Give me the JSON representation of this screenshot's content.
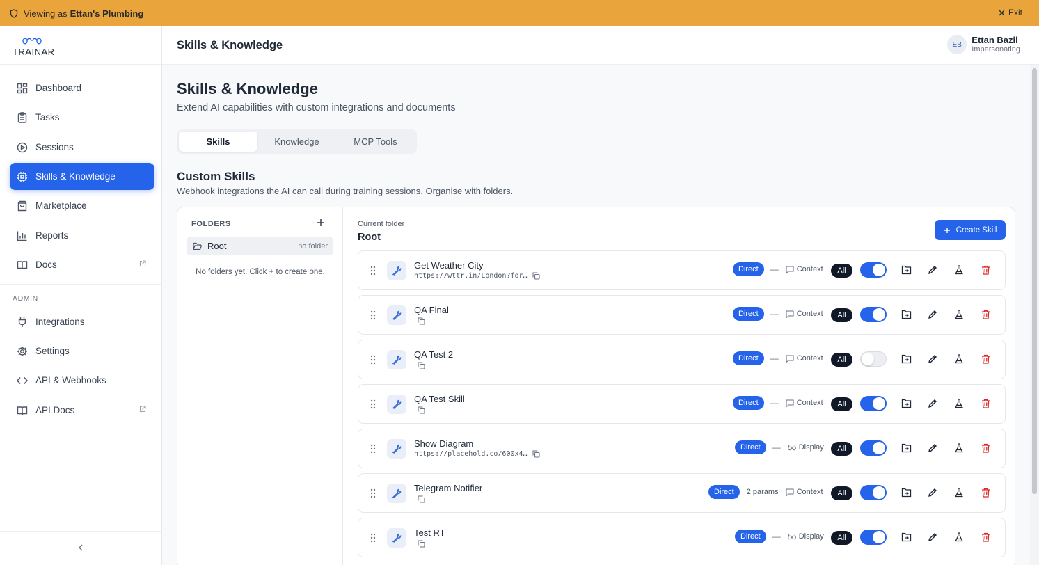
{
  "banner": {
    "prefix": "Viewing as",
    "account": "Ettan's Plumbing",
    "exit_label": "Exit",
    "color": "#e9a43b"
  },
  "brand": {
    "name": "TRAINAR"
  },
  "sidebar": {
    "items": [
      {
        "label": "Dashboard",
        "icon": "dashboard-icon"
      },
      {
        "label": "Tasks",
        "icon": "clipboard-icon"
      },
      {
        "label": "Sessions",
        "icon": "play-circle-icon"
      },
      {
        "label": "Skills & Knowledge",
        "icon": "cpu-icon",
        "active": true
      },
      {
        "label": "Marketplace",
        "icon": "shopping-bag-icon"
      },
      {
        "label": "Reports",
        "icon": "bar-chart-icon"
      },
      {
        "label": "Docs",
        "icon": "book-icon",
        "external": true
      }
    ],
    "admin_label": "ADMIN",
    "admin_items": [
      {
        "label": "Integrations",
        "icon": "plug-icon"
      },
      {
        "label": "Settings",
        "icon": "gear-icon"
      },
      {
        "label": "API & Webhooks",
        "icon": "code-icon"
      },
      {
        "label": "API Docs",
        "icon": "book-icon",
        "external": true
      }
    ]
  },
  "header": {
    "title": "Skills & Knowledge",
    "user": {
      "initials": "EB",
      "name": "Ettan Bazil",
      "role": "Impersonating"
    }
  },
  "main": {
    "title": "Skills & Knowledge",
    "subtitle": "Extend AI capabilities with custom integrations and documents",
    "tabs": [
      {
        "label": "Skills",
        "active": true
      },
      {
        "label": "Knowledge"
      },
      {
        "label": "MCP Tools"
      }
    ],
    "section_title": "Custom Skills",
    "section_subtitle": "Webhook integrations the AI can call during training sessions. Organise with folders."
  },
  "folders": {
    "label": "FOLDERS",
    "root_label": "Root",
    "root_note": "no folder",
    "empty_note": "No folders yet. Click + to create one."
  },
  "skills_panel": {
    "current_folder_label": "Current folder",
    "current_folder": "Root",
    "create_label": "Create Skill"
  },
  "skills": [
    {
      "name": "Get Weather City",
      "url": "https://wttr.in/London?for…",
      "mode": "Direct",
      "params": "—",
      "kind": "Context",
      "scope": "All",
      "enabled": true
    },
    {
      "name": "QA Final",
      "url": "",
      "mode": "Direct",
      "params": "—",
      "kind": "Context",
      "scope": "All",
      "enabled": true
    },
    {
      "name": "QA Test 2",
      "url": "",
      "mode": "Direct",
      "params": "—",
      "kind": "Context",
      "scope": "All",
      "enabled": false
    },
    {
      "name": "QA Test Skill",
      "url": "",
      "mode": "Direct",
      "params": "—",
      "kind": "Context",
      "scope": "All",
      "enabled": true
    },
    {
      "name": "Show Diagram",
      "url": "https://placehold.co/600x4…",
      "mode": "Direct",
      "params": "—",
      "kind": "Display",
      "scope": "All",
      "enabled": true
    },
    {
      "name": "Telegram Notifier",
      "url": "",
      "mode": "Direct",
      "params": "2 params",
      "kind": "Context",
      "scope": "All",
      "enabled": true
    },
    {
      "name": "Test RT",
      "url": "",
      "mode": "Direct",
      "params": "—",
      "kind": "Display",
      "scope": "All",
      "enabled": true
    }
  ],
  "colors": {
    "accent": "#2563eb",
    "danger": "#dc2626"
  }
}
